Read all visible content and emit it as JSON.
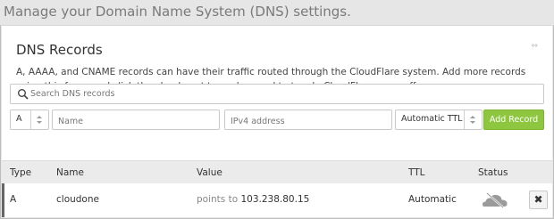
{
  "header": {
    "title": "Manage your Domain Name System (DNS) settings."
  },
  "card": {
    "title": "DNS Records",
    "collapse_icon": "⇔",
    "description": "A, AAAA, and CNAME records can have their traffic routed through the CloudFlare system. Add more records using this form, and click the cloud next to each record to toggle CloudFlare on or off."
  },
  "search": {
    "placeholder": "Search DNS records"
  },
  "form": {
    "type_value": "A",
    "name_placeholder": "Name",
    "address_placeholder": "IPv4 address",
    "ttl_value": "Automatic TTL",
    "add_label": "Add Record"
  },
  "table": {
    "headers": [
      "Type",
      "Name",
      "Value",
      "TTL",
      "Status"
    ],
    "rows": [
      {
        "type": "A",
        "name": "cloudone",
        "value_prefix": "points to",
        "value": "103.238.80.15",
        "ttl": "Automatic",
        "delete_label": "✖"
      }
    ]
  },
  "icons": {
    "search": "search-icon",
    "cloud": "cloud-icon",
    "delete": "close-icon"
  },
  "colors": {
    "accent": "#8ec63f",
    "cloud_gray": "#9a9a9a"
  }
}
